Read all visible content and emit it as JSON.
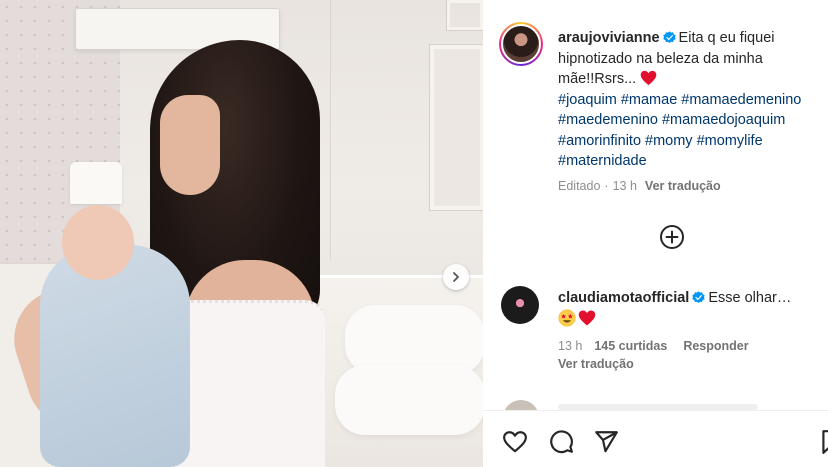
{
  "post": {
    "username": "araujovivianne",
    "caption_text": "Eita q eu fiquei hipnotizado na beleza da minha mãe!!Rsrs...",
    "hashtags": [
      "#joaquim",
      "#mamae",
      "#mamaedemenino",
      "#maedemenino",
      "#mamaedojoaquim",
      "#amorinfinito",
      "#momy",
      "#momylife",
      "#maternidade"
    ],
    "edited_label": "Editado",
    "age": "13 h",
    "translate_label": "Ver tradução"
  },
  "comments": [
    {
      "username": "claudiamotaofficial",
      "text": "Esse olhar…",
      "age": "13 h",
      "likes": "145 curtidas",
      "reply_label": "Responder",
      "translate_label": "Ver tradução",
      "emojis": [
        "star-struck-emoji",
        "red-heart-emoji"
      ]
    }
  ],
  "icons": {
    "verified": "verified-badge-icon",
    "more": "plus-circle-icon",
    "next": "chevron-right-icon",
    "actions": [
      "heart-icon",
      "comment-icon",
      "share-icon",
      "bookmark-icon"
    ]
  },
  "colors": {
    "text": "#262626",
    "muted": "#8e8e8e",
    "hashtag": "#00376b",
    "verified": "#0095f6",
    "heart": "#ed4956"
  }
}
